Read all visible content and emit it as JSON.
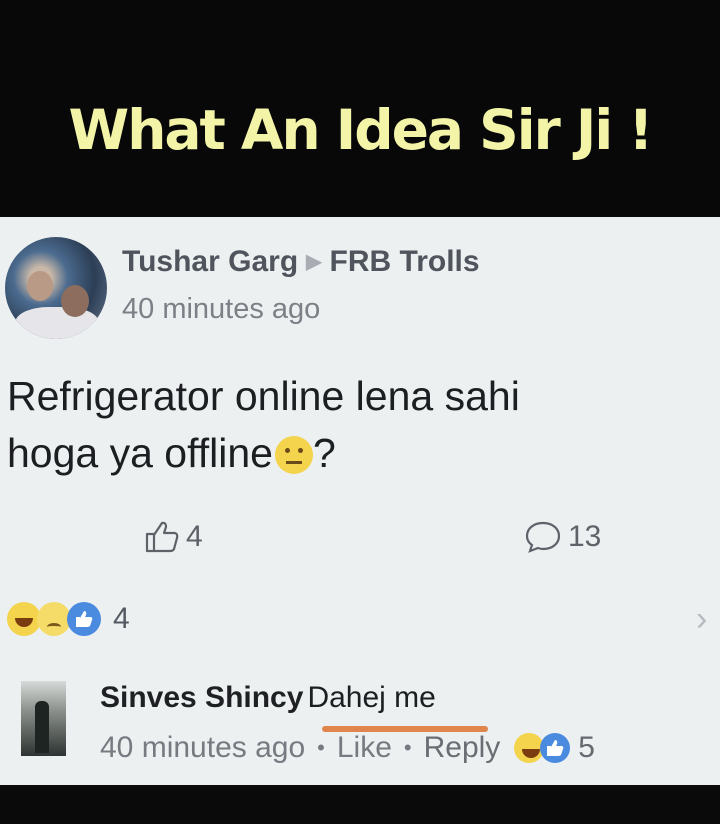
{
  "banner": {
    "title": "What An Idea Sir Ji !"
  },
  "post": {
    "author": "Tushar Garg",
    "group": "FRB Trolls",
    "time": "40 minutes ago",
    "text_line1": "Refrigerator online lena sahi",
    "text_line2": "hoga ya offline",
    "text_end": "?",
    "likes": "4",
    "comments": "13",
    "reaction_count": "4"
  },
  "comment": {
    "author": "Sinves Shincy",
    "text": "Dahej me",
    "time": "40 minutes ago",
    "like_label": "Like",
    "reply_label": "Reply",
    "reaction_count": "5"
  },
  "icons": [
    "thumbs-up-icon",
    "comment-icon",
    "haha-reaction-icon",
    "sad-reaction-icon",
    "like-reaction-icon",
    "chevron-right-icon",
    "confused-emoji"
  ],
  "colors": {
    "banner_text": "#f3f4a8",
    "card_bg": "#ecf0f1",
    "highlight": "#e0854b"
  }
}
